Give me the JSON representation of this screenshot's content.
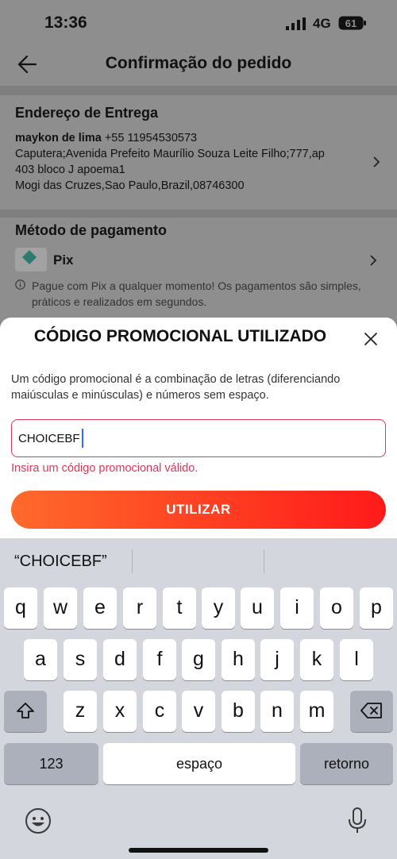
{
  "status": {
    "time": "13:36",
    "network": "4G",
    "battery": "61"
  },
  "header": {
    "title": "Confirmação do pedido"
  },
  "address": {
    "heading": "Endereço de Entrega",
    "name": "maykon de lima",
    "phone": "+55 11954530573",
    "line1": "Caputera;Avenida Prefeito Maurílio Souza Leite Filho;777,ap",
    "line2": "403 bloco J apoema1",
    "line3": "Mogi das Cruzes,Sao Paulo,Brazil,08746300"
  },
  "payment": {
    "heading": "Método de pagamento",
    "method": "Pix",
    "info": "Pague com Pix a qualquer momento! Os pagamentos são simples, práticos e realizados em segundos."
  },
  "promo": {
    "title": "CÓDIGO PROMOCIONAL UTILIZADO",
    "description": "Um código promocional é a combinação de letras (diferenciando maiúsculas e minúsculas) e números sem espaço.",
    "value": "CHOICEBF",
    "error": "Insira um código promocional válido.",
    "button": "UTILIZAR"
  },
  "keyboard": {
    "suggestion": "“CHOICEBF”",
    "row1": [
      "q",
      "w",
      "e",
      "r",
      "t",
      "y",
      "u",
      "i",
      "o",
      "p"
    ],
    "row2": [
      "a",
      "s",
      "d",
      "f",
      "g",
      "h",
      "j",
      "k",
      "l"
    ],
    "row3": [
      "z",
      "x",
      "c",
      "v",
      "b",
      "n",
      "m"
    ],
    "numbers_key": "123",
    "space_key": "espaço",
    "return_key": "retorno"
  },
  "colors": {
    "accent_gradient_start": "#ff6a2b",
    "accent_gradient_end": "#ff1a1a",
    "error": "#e0365a",
    "caret": "#2f6bff"
  }
}
